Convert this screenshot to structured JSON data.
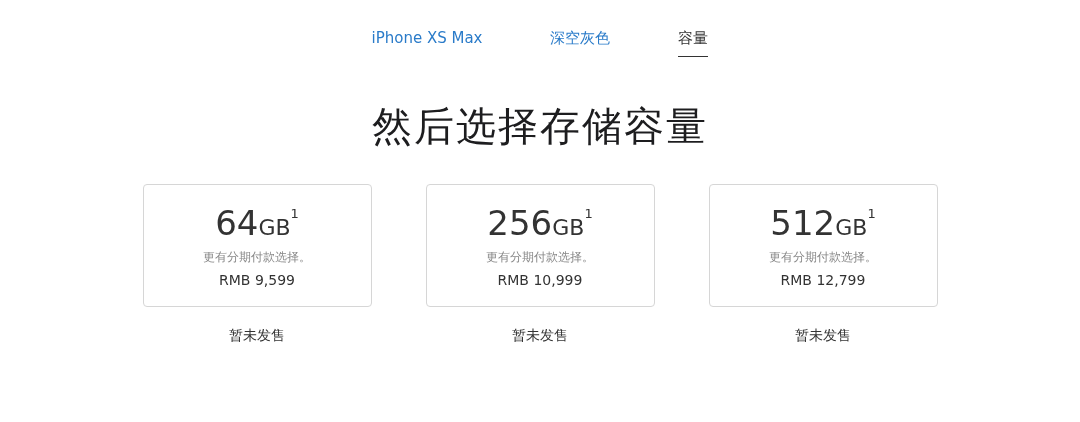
{
  "steps": [
    {
      "label": "iPhone XS Max",
      "selected": false
    },
    {
      "label": "深空灰色",
      "selected": false
    },
    {
      "label": "容量",
      "selected": true
    }
  ],
  "heading": "然后选择存储容量",
  "options": [
    {
      "size": "64",
      "unit": "GB",
      "footnote": "1",
      "note": "更有分期付款选择。",
      "price": "RMB 9,599",
      "availability": "暂未发售"
    },
    {
      "size": "256",
      "unit": "GB",
      "footnote": "1",
      "note": "更有分期付款选择。",
      "price": "RMB 10,999",
      "availability": "暂未发售"
    },
    {
      "size": "512",
      "unit": "GB",
      "footnote": "1",
      "note": "更有分期付款选择。",
      "price": "RMB 12,799",
      "availability": "暂未发售"
    }
  ]
}
